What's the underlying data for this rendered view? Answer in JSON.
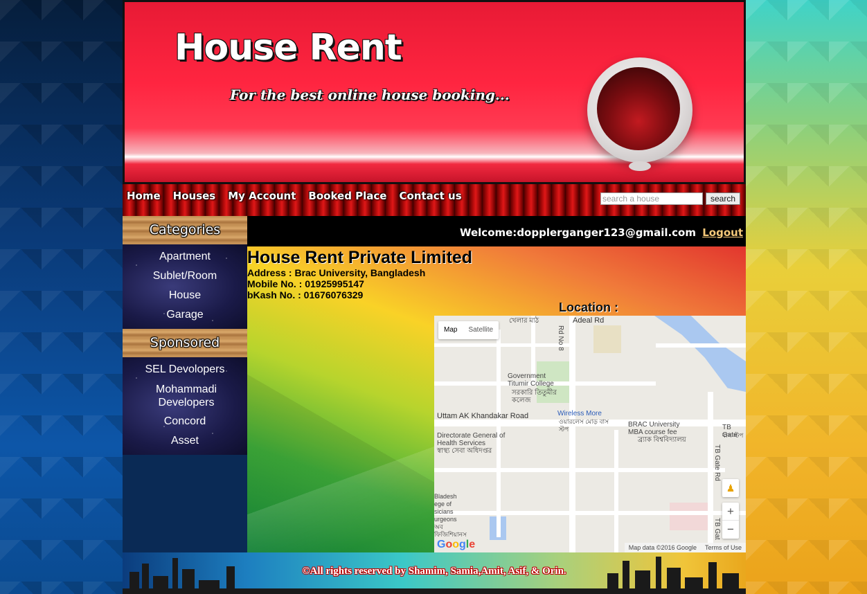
{
  "header": {
    "title": "House Rent",
    "tagline": "For the best online house booking..."
  },
  "nav": {
    "items": [
      "Home",
      "Houses",
      "My Account",
      "Booked Place",
      "Contact us"
    ],
    "search_placeholder": "search a house",
    "search_value": "",
    "search_button": "search"
  },
  "sidebar": {
    "categories_title": "Categories",
    "categories": [
      "Apartment",
      "Sublet/Room",
      "House",
      "Garage"
    ],
    "sponsored_title": "Sponsored",
    "sponsored": [
      "SEL Devolopers",
      "Mohammadi Developers",
      "Concord",
      "Asset"
    ]
  },
  "welcome": {
    "label": "Welcome:",
    "email": "dopplerganger123@gmail.com",
    "logout": "Logout"
  },
  "company": {
    "name": "House Rent Private Limited",
    "address": "Address : Brac University, Bangladesh",
    "mobile": "Mobile No. : 01925995147",
    "bkash": "bKash No. : 01676076329",
    "location_label": "Location :"
  },
  "map": {
    "type_map": "Map",
    "type_satellite": "Satellite",
    "labels": {
      "adeal": "Adeal Rd",
      "field": "খেলার মাঠ",
      "rd8": "Rd No 8",
      "titumir_en": "Government Titumir College",
      "titumir_bn": "সরকারি তিতুমীর কলেজ",
      "uttam": "Uttam AK Khandakar Road",
      "wireless_en": "Wireless More",
      "wireless_bn": "ওয়ারলেস মোড় বাস স্টপ",
      "brac_en": "BRAC University MBA course fee",
      "brac_bn": "ব্র্যাক বিশ্ববিদ্যালয়",
      "dghs_en": "Directorate General of Health Services",
      "dghs_bn": "স্বাস্থ্য সেবা অধিদপ্তর",
      "tbgate": "TB Gate",
      "tbgate_bn": "বাস স্টপ",
      "tbgate_rd": "TB Gate Rd",
      "tbgate2": "TB Gat",
      "college_left": "Bladesh ege of sicians urgeons অব ফিজিশিয়ানস"
    },
    "zoom_in": "+",
    "zoom_out": "−",
    "pegman_icon": "pegman-icon",
    "data_text": "Map data ©2016 Google",
    "terms_text": "Terms of Use",
    "logo": "Google"
  },
  "footer": {
    "copyright": "©All rights reserved by Shamim, Samia,Amit, Asif, & Orin."
  }
}
